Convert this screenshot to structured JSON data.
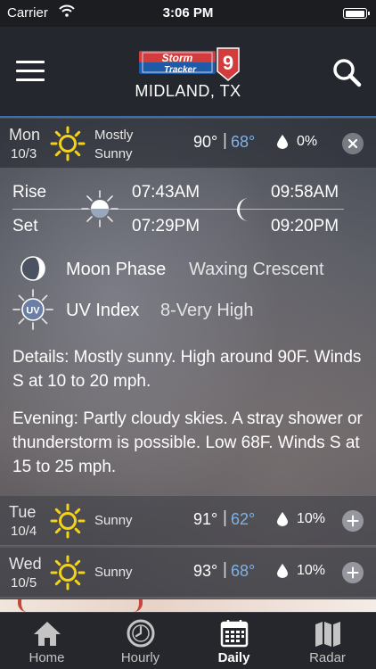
{
  "status_bar": {
    "carrier": "Carrier",
    "time": "3:06 PM"
  },
  "header": {
    "logo_text_top": "Storm",
    "logo_text_bottom": "Tracker",
    "logo_number": "9",
    "location": "MIDLAND, TX"
  },
  "days": [
    {
      "name": "Mon",
      "date": "10/3",
      "condition_line1": "Mostly",
      "condition_line2": "Sunny",
      "high": "90°",
      "separator": "|",
      "low": "68°",
      "precip": "0%",
      "expanded": true
    },
    {
      "name": "Tue",
      "date": "10/4",
      "condition": "Sunny",
      "high": "91°",
      "separator": "|",
      "low": "62°",
      "precip": "10%",
      "expanded": false
    },
    {
      "name": "Wed",
      "date": "10/5",
      "condition": "Sunny",
      "high": "93°",
      "separator": "|",
      "low": "68°",
      "precip": "10%",
      "expanded": false
    }
  ],
  "details": {
    "rise_label": "Rise",
    "set_label": "Set",
    "sunrise": "07:43AM",
    "sunset": "07:29PM",
    "moonrise": "09:58AM",
    "moonset": "09:20PM",
    "moon_phase_label": "Moon Phase",
    "moon_phase_value": "Waxing Crescent",
    "uv_label": "UV Index",
    "uv_badge": "UV",
    "uv_value": "8-Very High",
    "details_text": "Details: Mostly sunny. High around 90F. Winds S at 10 to 20 mph.",
    "evening_text": "Evening: Partly cloudy skies. A stray shower or thunderstorm is possible. Low 68F. Winds S at 15 to 25 mph."
  },
  "tabs": [
    {
      "label": "Home",
      "icon": "home-icon",
      "active": false
    },
    {
      "label": "Hourly",
      "icon": "clock-icon",
      "active": false
    },
    {
      "label": "Daily",
      "icon": "calendar-icon",
      "active": true
    },
    {
      "label": "Radar",
      "icon": "map-icon",
      "active": false
    }
  ],
  "colors": {
    "accent_blue": "#3c6ea8",
    "low_temp": "#7fb2e6",
    "sun_yellow": "#f5d21a",
    "tab_bg": "#25272c"
  }
}
